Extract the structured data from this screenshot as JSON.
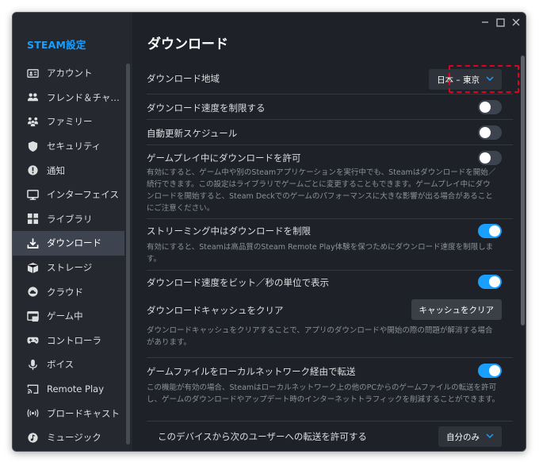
{
  "sidebar": {
    "title": "STEAM設定",
    "items": [
      {
        "label": "アカウント",
        "icon": "account-icon"
      },
      {
        "label": "フレンド＆チャ…",
        "icon": "friends-icon"
      },
      {
        "label": "ファミリー",
        "icon": "family-icon"
      },
      {
        "label": "セキュリティ",
        "icon": "shield-icon"
      },
      {
        "label": "通知",
        "icon": "notification-icon"
      },
      {
        "label": "インターフェイス",
        "icon": "monitor-icon"
      },
      {
        "label": "ライブラリ",
        "icon": "library-icon"
      },
      {
        "label": "ダウンロード",
        "icon": "download-icon",
        "active": true
      },
      {
        "label": "ストレージ",
        "icon": "storage-icon"
      },
      {
        "label": "クラウド",
        "icon": "cloud-icon"
      },
      {
        "label": "ゲーム中",
        "icon": "ingame-icon"
      },
      {
        "label": "コントローラ",
        "icon": "controller-icon"
      },
      {
        "label": "ボイス",
        "icon": "microphone-icon"
      },
      {
        "label": "Remote Play",
        "icon": "remote-play-icon"
      },
      {
        "label": "ブロードキャスト",
        "icon": "broadcast-icon"
      },
      {
        "label": "ミュージック",
        "icon": "music-icon"
      }
    ]
  },
  "main": {
    "title": "ダウンロード",
    "region": {
      "label": "ダウンロード地域",
      "value": "日本 – 東京"
    },
    "limit_speed": {
      "label": "ダウンロード速度を制限する",
      "enabled": false
    },
    "auto_update": {
      "label": "自動更新スケジュール",
      "enabled": false
    },
    "gameplay_download": {
      "label": "ゲームプレイ中にダウンロードを許可",
      "enabled": false,
      "desc": [
        "有効にすると、ゲーム中や別のSteamアプリケーションを実行中でも、Steamはダウンロードを開始／",
        "続行できます。この設定はライブラリでゲームごとに変更することもできます。ゲームプレイ中にダウ",
        "ンロードを開始すると、Steam Deckでのゲームのパフォーマンスに大きな影響が出る場合があること",
        "にご注意ください。"
      ]
    },
    "streaming_limit": {
      "label": "ストリーミング中はダウンロードを制限",
      "enabled": true,
      "desc": [
        "有効にすると、Steamは高品質のSteam Remote Play体験を保つためにダウンロード速度を制限しま",
        "す。"
      ]
    },
    "bits_display": {
      "label": "ダウンロード速度をビット／秒の単位で表示",
      "enabled": true
    },
    "cache": {
      "label": "ダウンロードキャッシュをクリア",
      "button": "キャッシュをクリア",
      "desc": [
        "ダウンロードキャッシュをクリアすることで、アプリのダウンロードや開始の際の問題が解消する場合",
        "があります。"
      ]
    },
    "lan_transfer": {
      "label": "ゲームファイルをローカルネットワーク経由で転送",
      "enabled": true,
      "desc": [
        "この機能が有効の場合、Steamはローカルネットワーク上の他のPCからのゲームファイルの転送を許可",
        "し、ゲームのダウンロードやアップデート時のインターネットトラフィックを削減することができます。"
      ]
    },
    "transfer_users": {
      "label": "このデバイスから次のユーザーへの転送を許可する",
      "value": "自分のみ"
    }
  },
  "colors": {
    "accent": "#1a9fff",
    "highlight": "#e1001e",
    "background": "#1e2128",
    "sidebar": "#25282f"
  }
}
